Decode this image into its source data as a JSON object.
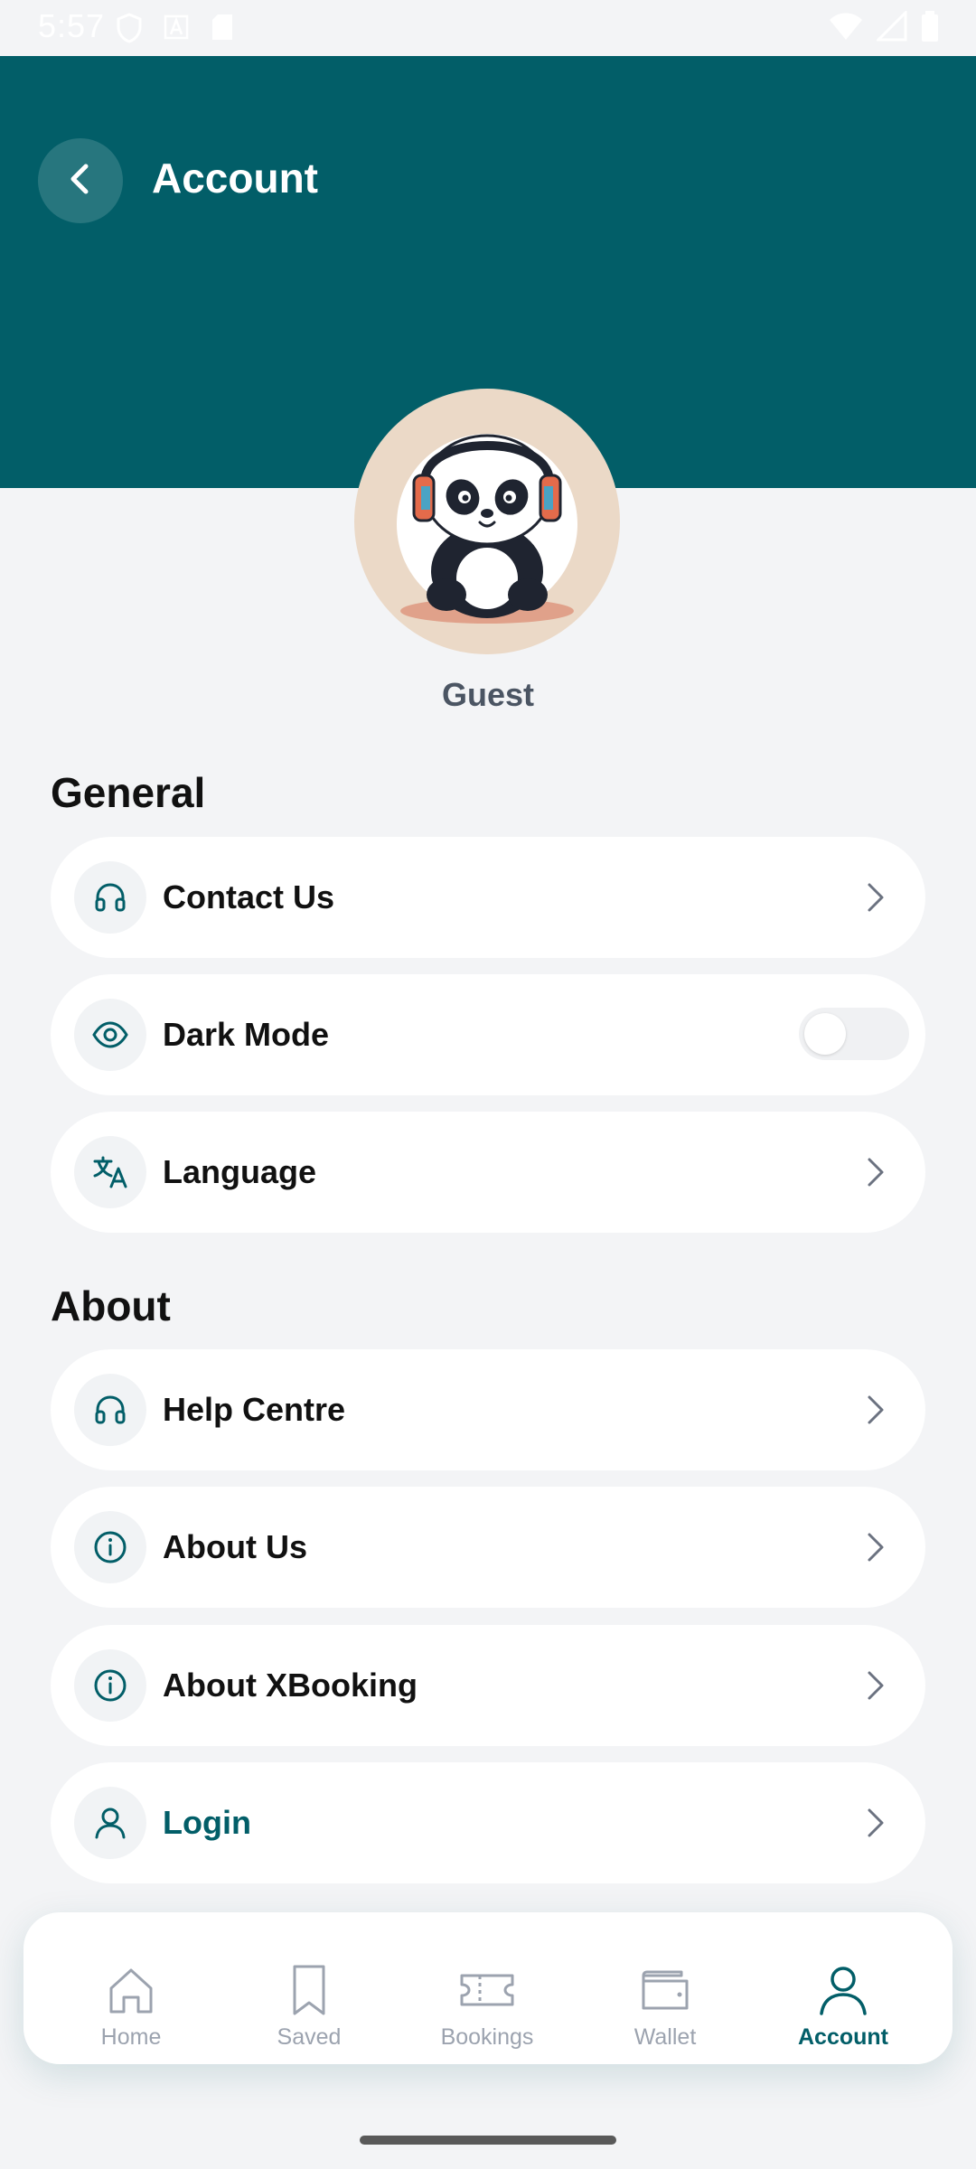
{
  "status_bar": {
    "time": "5:57"
  },
  "header": {
    "title": "Account"
  },
  "profile": {
    "name": "Guest"
  },
  "sections": {
    "general": {
      "title": "General",
      "items": [
        {
          "label": "Contact Us",
          "icon": "headset-icon"
        },
        {
          "label": "Dark Mode",
          "icon": "eye-icon",
          "toggle": false
        },
        {
          "label": "Language",
          "icon": "translate-icon"
        }
      ]
    },
    "about": {
      "title": "About",
      "items": [
        {
          "label": "Help Centre",
          "icon": "headset-icon"
        },
        {
          "label": "About Us",
          "icon": "info-icon"
        },
        {
          "label": "About XBooking",
          "icon": "info-icon"
        },
        {
          "label": "Login",
          "icon": "user-icon"
        }
      ]
    }
  },
  "bottom_nav": {
    "items": [
      {
        "label": "Home",
        "icon": "home-icon"
      },
      {
        "label": "Saved",
        "icon": "bookmark-icon"
      },
      {
        "label": "Bookings",
        "icon": "ticket-icon"
      },
      {
        "label": "Wallet",
        "icon": "wallet-icon"
      },
      {
        "label": "Account",
        "icon": "user-icon",
        "active": true
      }
    ]
  },
  "colors": {
    "primary": "#025e68",
    "background": "#f3f4f6",
    "card": "#ffffff",
    "muted": "#9ca3af"
  }
}
